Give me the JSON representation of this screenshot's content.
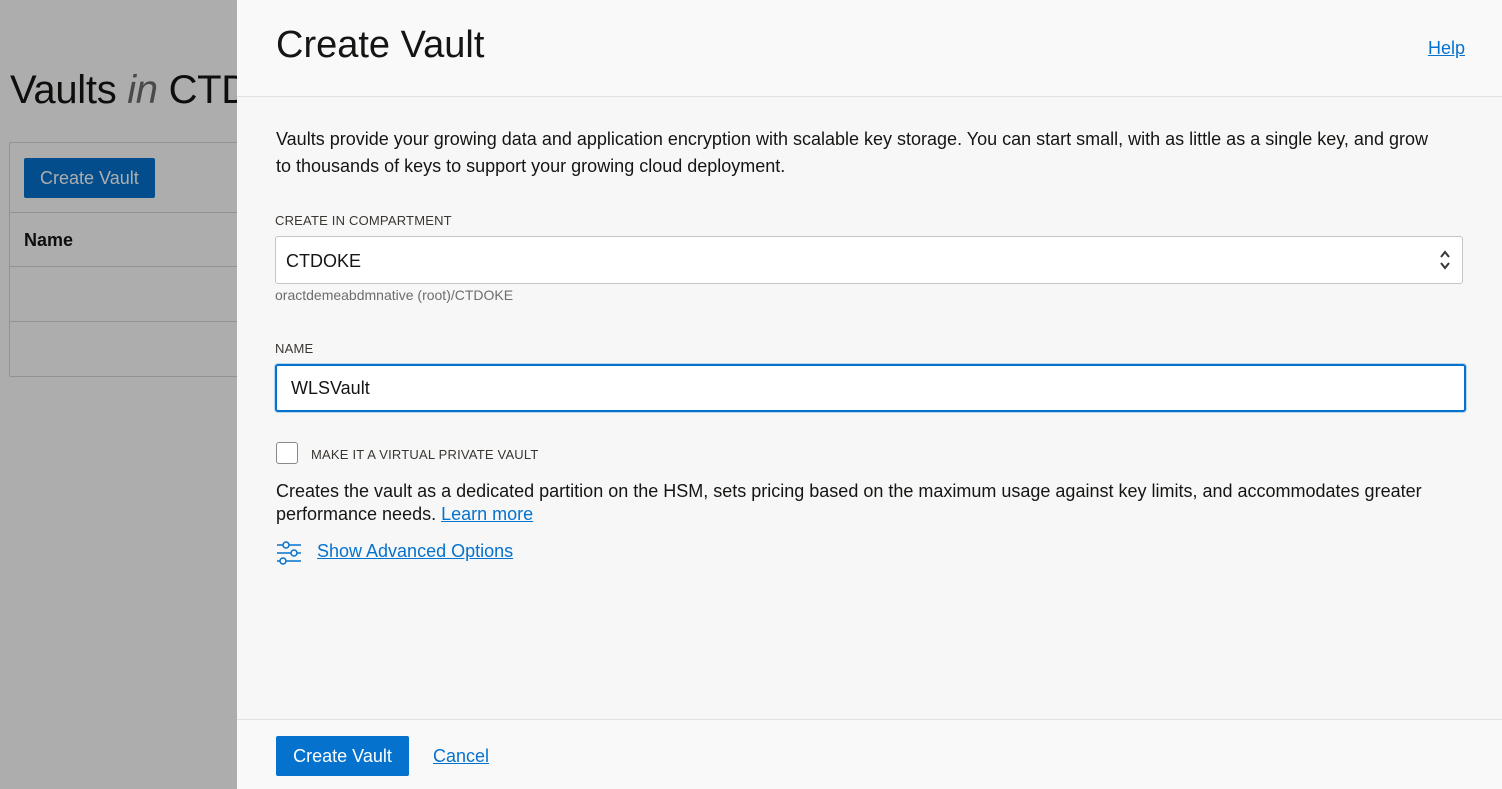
{
  "background": {
    "title_prefix": "Vaults ",
    "title_in": "in",
    "title_suffix": " CTDOKE",
    "create_button": "Create Vault",
    "table_header_name": "Name"
  },
  "panel": {
    "title": "Create Vault",
    "help": "Help",
    "intro": "Vaults provide your growing data and application encryption with scalable key storage. You can start small, with as little as a single key, and grow to thousands of keys to support your growing cloud deployment.",
    "compartment": {
      "label": "CREATE IN COMPARTMENT",
      "value": "CTDOKE",
      "helper": "oractdemeabdmnative (root)/CTDOKE"
    },
    "name": {
      "label": "NAME",
      "value": "WLSVault"
    },
    "virtual_private": {
      "label": "MAKE IT A VIRTUAL PRIVATE VAULT",
      "checked": false,
      "description": "Creates the vault as a dedicated partition on the HSM, sets pricing based on the maximum usage against key limits, and accommodates greater performance needs.",
      "learn_more": "Learn more"
    },
    "advanced": "Show Advanced Options",
    "footer": {
      "create": "Create Vault",
      "cancel": "Cancel"
    }
  },
  "colors": {
    "accent": "#0572ce",
    "overlay": "#00000052"
  },
  "icons": {
    "select": "chevron-up-down-icon",
    "advanced": "sliders-icon"
  }
}
